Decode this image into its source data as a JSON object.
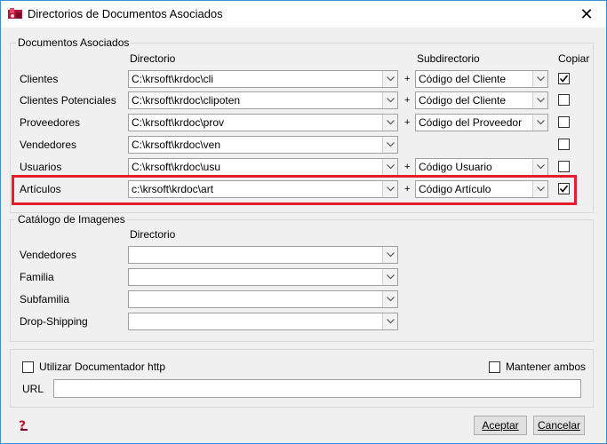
{
  "window": {
    "title": "Directorios de Documentos Asociados",
    "close_glyph": "✕"
  },
  "docs": {
    "group_title": "Documentos Asociados",
    "col_directorio": "Directorio",
    "col_subdirectorio": "Subdirectorio",
    "col_copiar": "Copiar",
    "plus": "+",
    "rows": [
      {
        "label": "Clientes",
        "dir": "C:\\krsoft\\krdoc\\cli",
        "sub": "Código del Cliente",
        "copiar": true
      },
      {
        "label": "Clientes Potenciales",
        "dir": "C:\\krsoft\\krdoc\\clipoten",
        "sub": "Código del Cliente",
        "copiar": false
      },
      {
        "label": "Proveedores",
        "dir": "C:\\krsoft\\krdoc\\prov",
        "sub": "Código del Proveedor",
        "copiar": false
      },
      {
        "label": "Vendedores",
        "dir": "C:\\krsoft\\krdoc\\ven",
        "sub": "",
        "copiar": false
      },
      {
        "label": "Usuarios",
        "dir": "C:\\krsoft\\krdoc\\usu",
        "sub": "Código Usuario",
        "copiar": false
      },
      {
        "label": "Artículos",
        "dir": "c:\\krsoft\\krdoc\\art",
        "sub": "Código Artículo",
        "copiar": true
      }
    ]
  },
  "images": {
    "group_title": "Catálogo de Imagenes",
    "col_directorio": "Directorio",
    "rows": [
      {
        "label": "Vendedores",
        "dir": ""
      },
      {
        "label": "Familia",
        "dir": ""
      },
      {
        "label": "Subfamilia",
        "dir": ""
      },
      {
        "label": "Drop-Shipping",
        "dir": ""
      }
    ]
  },
  "http": {
    "utilizar_label": "Utilizar Documentador http",
    "utilizar_checked": false,
    "mantener_label": "Mantener ambos",
    "mantener_checked": false,
    "url_label": "URL",
    "url_value": ""
  },
  "buttons": {
    "aceptar": "Aceptar",
    "cancelar": "Cancelar"
  },
  "colors": {
    "highlight": "#e41e2b",
    "window_border": "#3a8fd8"
  }
}
